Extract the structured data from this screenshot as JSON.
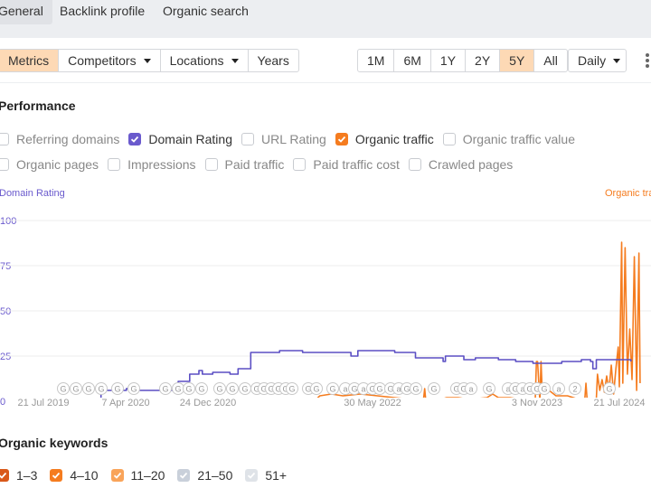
{
  "tabs": [
    {
      "label": "General",
      "active": true
    },
    {
      "label": "Backlink profile",
      "active": false
    },
    {
      "label": "Organic search",
      "active": false
    }
  ],
  "view_buttons": [
    {
      "label": "Metrics",
      "selected": true,
      "dropdown": false
    },
    {
      "label": "Competitors",
      "selected": false,
      "dropdown": true
    },
    {
      "label": "Locations",
      "selected": false,
      "dropdown": true
    },
    {
      "label": "Years",
      "selected": false,
      "dropdown": false
    }
  ],
  "range_buttons": [
    {
      "label": "1M",
      "selected": false
    },
    {
      "label": "6M",
      "selected": false
    },
    {
      "label": "1Y",
      "selected": false
    },
    {
      "label": "2Y",
      "selected": false
    },
    {
      "label": "5Y",
      "selected": true
    },
    {
      "label": "All",
      "selected": false
    }
  ],
  "interval": {
    "label": "Daily"
  },
  "performance": {
    "title": "Performance",
    "metrics_row1": [
      {
        "label": "Referring domains",
        "checked": false,
        "color": ""
      },
      {
        "label": "Domain Rating",
        "checked": true,
        "color": "#6a5acd"
      },
      {
        "label": "URL Rating",
        "checked": false,
        "color": ""
      },
      {
        "label": "Organic traffic",
        "checked": true,
        "color": "#f57c1f"
      },
      {
        "label": "Organic traffic value",
        "checked": false,
        "color": ""
      }
    ],
    "metrics_row2": [
      {
        "label": "Organic pages",
        "checked": false
      },
      {
        "label": "Impressions",
        "checked": false
      },
      {
        "label": "Paid traffic",
        "checked": false
      },
      {
        "label": "Paid traffic cost",
        "checked": false
      },
      {
        "label": "Crawled pages",
        "checked": false
      }
    ]
  },
  "chart_data": {
    "type": "line",
    "title": "Performance",
    "left_axis_label": "Domain Rating",
    "right_axis_label": "Organic traffic",
    "ylim": [
      0,
      100
    ],
    "yticks": [
      "0",
      "25",
      "50",
      "75",
      "100"
    ],
    "xtick_labels": [
      "21 Jul 2019",
      "7 Apr 2020",
      "24 Dec 2020",
      "30 May 2022",
      "3 Nov 2023",
      "21 Jul 2024"
    ],
    "grid": true,
    "series": [
      {
        "name": "Domain Rating",
        "color": "#5b4fc4",
        "axis": "left",
        "points": [
          [
            2020.04,
            0
          ],
          [
            2020.05,
            6
          ],
          [
            2020.25,
            6
          ],
          [
            2020.27,
            7
          ],
          [
            2020.3,
            6
          ],
          [
            2020.7,
            6
          ],
          [
            2020.72,
            11
          ],
          [
            2020.8,
            11
          ],
          [
            2020.82,
            15
          ],
          [
            2020.87,
            15
          ],
          [
            2020.9,
            17
          ],
          [
            2020.93,
            15
          ],
          [
            2021.0,
            15
          ],
          [
            2021.02,
            16
          ],
          [
            2021.15,
            16
          ],
          [
            2021.17,
            15
          ],
          [
            2021.22,
            15
          ],
          [
            2021.24,
            18
          ],
          [
            2021.32,
            18
          ],
          [
            2021.35,
            27
          ],
          [
            2021.55,
            27
          ],
          [
            2021.6,
            28
          ],
          [
            2021.78,
            28
          ],
          [
            2021.8,
            27
          ],
          [
            2022.0,
            27
          ],
          [
            2022.2,
            27
          ],
          [
            2022.22,
            25
          ],
          [
            2022.26,
            25
          ],
          [
            2022.28,
            28
          ],
          [
            2022.55,
            28
          ],
          [
            2022.6,
            27
          ],
          [
            2022.75,
            27
          ],
          [
            2022.78,
            24
          ],
          [
            2023.0,
            24
          ],
          [
            2023.02,
            22
          ],
          [
            2023.04,
            25
          ],
          [
            2023.15,
            25
          ],
          [
            2023.2,
            23
          ],
          [
            2023.3,
            24
          ],
          [
            2023.45,
            24
          ],
          [
            2023.5,
            23
          ],
          [
            2023.6,
            23
          ],
          [
            2023.65,
            22
          ],
          [
            2023.75,
            22
          ],
          [
            2023.8,
            21
          ],
          [
            2024.0,
            21
          ],
          [
            2024.05,
            22
          ],
          [
            2024.2,
            22
          ],
          [
            2024.22,
            23
          ],
          [
            2024.3,
            22
          ],
          [
            2024.32,
            18
          ],
          [
            2024.35,
            23
          ],
          [
            2024.45,
            23
          ],
          [
            2024.6,
            23
          ],
          [
            2024.65,
            22
          ]
        ]
      },
      {
        "name": "Organic traffic",
        "color": "#f57c1f",
        "axis": "right",
        "points": [
          [
            2019.0,
            0
          ],
          [
            2021.9,
            0
          ],
          [
            2021.95,
            3
          ],
          [
            2022.05,
            4
          ],
          [
            2022.15,
            3
          ],
          [
            2022.3,
            4
          ],
          [
            2022.45,
            3
          ],
          [
            2022.6,
            2
          ],
          [
            2022.75,
            1
          ],
          [
            2022.85,
            1
          ],
          [
            2022.86,
            7
          ],
          [
            2022.87,
            0
          ],
          [
            2022.95,
            0
          ],
          [
            2023.0,
            1
          ],
          [
            2023.05,
            2
          ],
          [
            2023.15,
            2
          ],
          [
            2023.25,
            1
          ],
          [
            2023.4,
            2
          ],
          [
            2023.45,
            4
          ],
          [
            2023.5,
            2
          ],
          [
            2023.6,
            2
          ],
          [
            2023.7,
            1
          ],
          [
            2023.82,
            1
          ],
          [
            2023.83,
            22
          ],
          [
            2023.84,
            22
          ],
          [
            2023.86,
            0
          ],
          [
            2023.87,
            22
          ],
          [
            2023.88,
            6
          ],
          [
            2023.92,
            7
          ],
          [
            2023.96,
            5
          ],
          [
            2024.0,
            3
          ],
          [
            2024.1,
            3
          ],
          [
            2024.2,
            1
          ],
          [
            2024.25,
            1
          ],
          [
            2024.26,
            10
          ],
          [
            2024.27,
            1
          ],
          [
            2024.35,
            1
          ],
          [
            2024.36,
            15
          ],
          [
            2024.38,
            6
          ],
          [
            2024.4,
            12
          ],
          [
            2024.42,
            5
          ],
          [
            2024.44,
            14
          ],
          [
            2024.46,
            6
          ],
          [
            2024.48,
            20
          ],
          [
            2024.5,
            4
          ],
          [
            2024.52,
            18
          ],
          [
            2024.54,
            30
          ],
          [
            2024.55,
            8
          ],
          [
            2024.57,
            88
          ],
          [
            2024.58,
            10
          ],
          [
            2024.6,
            85
          ],
          [
            2024.62,
            15
          ],
          [
            2024.64,
            40
          ],
          [
            2024.66,
            12
          ],
          [
            2024.68,
            80
          ],
          [
            2024.7,
            6
          ],
          [
            2024.72,
            82
          ],
          [
            2024.73,
            10
          ]
        ]
      }
    ],
    "annotations": {
      "marker_glyphs": [
        "G",
        "a",
        "2"
      ],
      "count_approx": 45
    }
  },
  "organic_keywords": {
    "title": "Organic keywords",
    "ranges": [
      {
        "label": "1–3",
        "checked": true,
        "color": "#d9591a"
      },
      {
        "label": "4–10",
        "checked": true,
        "color": "#f57c1f"
      },
      {
        "label": "11–20",
        "checked": true,
        "color": "#f9a45a"
      },
      {
        "label": "21–50",
        "checked": true,
        "color": "#c9d0da"
      },
      {
        "label": "51+",
        "checked": true,
        "color": "#dfe3e8"
      }
    ]
  }
}
